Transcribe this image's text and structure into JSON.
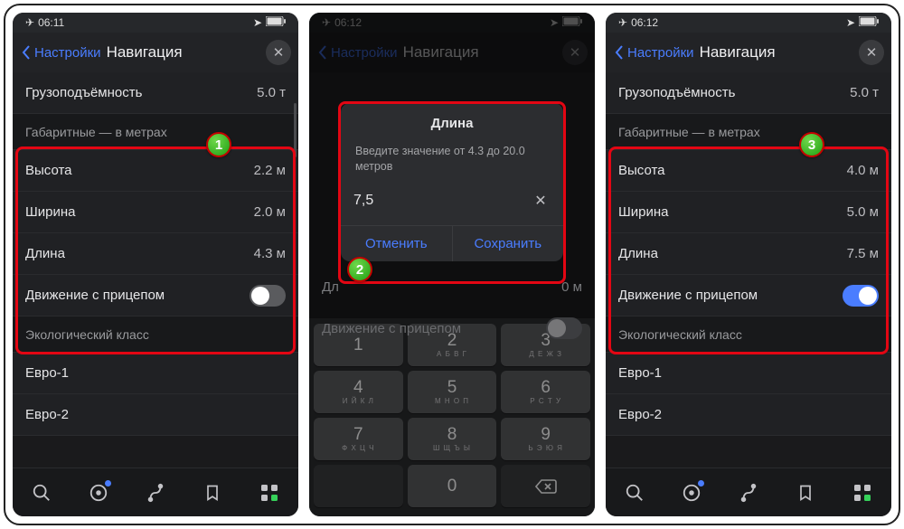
{
  "status": {
    "time1": "06:11",
    "time2": "06:12"
  },
  "header": {
    "back": "Настройки",
    "title": "Навигация"
  },
  "rows": {
    "capacity_label": "Грузоподъёмность",
    "capacity_val": "5.0 т",
    "dims_section": "Габаритные — в метрах",
    "height": "Высота",
    "width": "Ширина",
    "length": "Длина",
    "trailer": "Движение с прицепом",
    "eco_section": "Экологический класс",
    "euro1": "Евро-1",
    "euro2": "Евро-2"
  },
  "p1": {
    "h": "2.2 м",
    "w": "2.0 м",
    "l": "4.3 м"
  },
  "p3": {
    "h": "4.0 м",
    "w": "5.0 м",
    "l": "7.5 м"
  },
  "dialog": {
    "title": "Длина",
    "hint": "Введите значение от 4.3 до 20.0 метров",
    "value": "7,5",
    "cancel": "Отменить",
    "save": "Сохранить",
    "peek_l": "Дл",
    "peek_v": "0 м"
  },
  "keys": [
    [
      {
        "n": "1",
        "l": ""
      },
      {
        "n": "2",
        "l": "А Б В Г"
      },
      {
        "n": "3",
        "l": "Д Е Ж З"
      }
    ],
    [
      {
        "n": "4",
        "l": "И Й К Л"
      },
      {
        "n": "5",
        "l": "М Н О П"
      },
      {
        "n": "6",
        "l": "Р С Т У"
      }
    ],
    [
      {
        "n": "7",
        "l": "Ф Х Ц Ч"
      },
      {
        "n": "8",
        "l": "Ш Щ Ъ Ы"
      },
      {
        "n": "9",
        "l": "Ь Э Ю Я"
      }
    ]
  ],
  "badges": {
    "b1": "1",
    "b2": "2",
    "b3": "3"
  }
}
